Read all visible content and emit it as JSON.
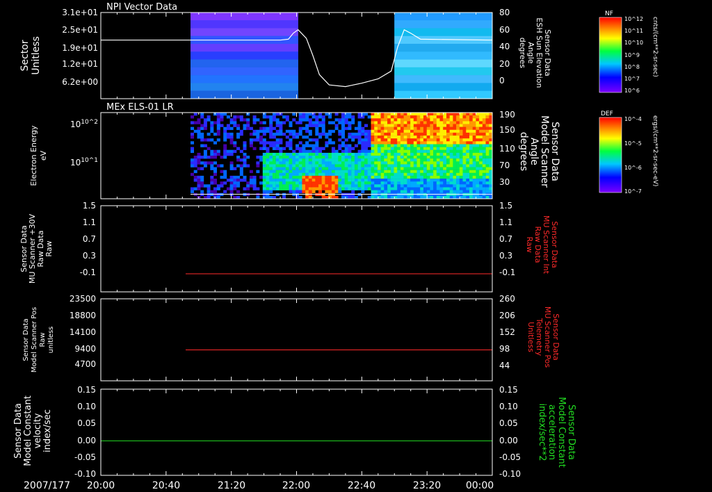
{
  "colors": {
    "background": "#000000",
    "foreground": "#ffffff",
    "red_trace": "#ff2a2a",
    "green_trace": "#22dd22"
  },
  "time_axis": {
    "date_label": "2007/177",
    "ticks": [
      "20:00",
      "20:40",
      "21:20",
      "22:00",
      "22:40",
      "23:20",
      "00:00"
    ],
    "start_min": 0,
    "end_min": 240
  },
  "colorbars": [
    {
      "name": "NF",
      "unit_label": "cnts/(cm**2-sr-sec)",
      "tick_labels": [
        "10^12",
        "10^11",
        "10^10",
        "10^9",
        "10^8",
        "10^7",
        "10^6"
      ]
    },
    {
      "name": "DEF",
      "unit_label": "ergs/(cm**2-sr-sec-eV)",
      "tick_labels": [
        "10^-4",
        "10^-5",
        "10^-6",
        "10^-7"
      ]
    }
  ],
  "chart_data": [
    {
      "type": "heatmap",
      "title": "NPI Vector Data",
      "ylabel": [
        "Sector",
        "Unitless"
      ],
      "yticks": [
        "3.1e+01",
        "2.5e+01",
        "1.9e+01",
        "1.2e+01",
        "6.2e+00"
      ],
      "data_intervals_min": [
        [
          55,
          121
        ],
        [
          180,
          240
        ]
      ],
      "overlay": {
        "type": "line",
        "ylabel": [
          "Sensor Data",
          "ESH Sun Elevation",
          "Angle",
          "degrees"
        ],
        "yticks": [
          80,
          60,
          40,
          20,
          0
        ],
        "ylim": [
          -20,
          80
        ],
        "x_min": [
          0,
          105,
          110,
          115,
          118,
          121,
          126,
          130,
          134,
          140,
          150,
          160,
          170,
          178,
          182,
          186,
          190,
          196,
          240
        ],
        "y": [
          48,
          48,
          48,
          49,
          56,
          60,
          50,
          30,
          8,
          -4,
          -6,
          -2,
          3,
          12,
          40,
          60,
          56,
          49,
          48
        ]
      }
    },
    {
      "type": "heatmap",
      "title": "MEx ELS-01 LR",
      "ylabel": [
        "Electron Energy",
        "eV"
      ],
      "yticks": [
        "10^2",
        "10^1"
      ],
      "data_interval_min": [
        55,
        240
      ],
      "overlay": {
        "type": "line",
        "ylabel": [
          "Sensor Data",
          "Model Scanner",
          "Angle",
          "degrees"
        ],
        "yticks": [
          190,
          150,
          110,
          70,
          30
        ],
        "ylim": [
          0,
          190
        ],
        "x_min": [
          55,
          240
        ],
        "y": [
          10,
          10
        ]
      }
    },
    {
      "type": "line",
      "ylabel_left": [
        "Sensor Data",
        "MU Scanner +30V",
        "Raw Data",
        "Raw"
      ],
      "ylabel_right": [
        "Sensor Data",
        "MU Scanner Int",
        "Raw Data",
        "Raw"
      ],
      "yticks": [
        "1.5",
        "1.1",
        "0.7",
        "0.3",
        "-0.1"
      ],
      "ylim": [
        -0.5,
        1.5
      ],
      "x_min": [
        52,
        240
      ],
      "y": [
        -0.08,
        -0.08
      ]
    },
    {
      "type": "line",
      "ylabel_left": [
        "Sensor Data",
        "Model Scanner Pos",
        "Raw",
        "unitless"
      ],
      "ylabel_right": [
        "Sensor Data",
        "MU Scanner Pos",
        "Telemetry",
        "Unitless"
      ],
      "yticks_left": [
        23500,
        18800,
        14100,
        9400,
        4700
      ],
      "yticks_right": [
        260,
        206,
        152,
        98,
        44
      ],
      "ylim": [
        0,
        23500
      ],
      "ylim_right": [
        0,
        260
      ],
      "x_min": [
        52,
        240
      ],
      "y_right": [
        98,
        98
      ]
    },
    {
      "type": "line",
      "ylabel_left": [
        "Sensor Data",
        "Model Constant",
        "velocity",
        "index/sec"
      ],
      "ylabel_right": [
        "Sensor Data",
        "Model Constant",
        "acceleration",
        "index/sec**2"
      ],
      "yticks": [
        "0.15",
        "0.10",
        "0.05",
        "0.00",
        "-0.05",
        "-0.10"
      ],
      "ylim": [
        -0.1,
        0.15
      ],
      "x_min": [
        0,
        240
      ],
      "y": [
        0,
        0
      ]
    }
  ]
}
